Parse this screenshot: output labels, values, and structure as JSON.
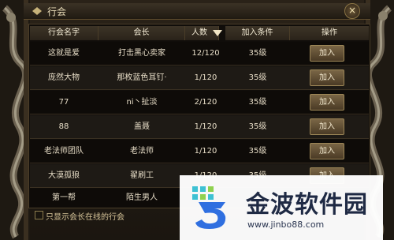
{
  "window": {
    "title": "行会",
    "close_symbol": "×"
  },
  "table": {
    "columns": [
      "行会名字",
      "会长",
      "人数",
      "加入条件",
      "操作"
    ],
    "sort_indicator": "down",
    "rows": [
      {
        "name": "这就是爱",
        "leader": "打击黑心卖家",
        "members": "12/120",
        "requirement": "35级",
        "action": "加入"
      },
      {
        "name": "庞然大物",
        "leader": "那枚蓝色耳钉·",
        "members": "1/120",
        "requirement": "35级",
        "action": "加入"
      },
      {
        "name": "77",
        "leader": "ni丶扯淡",
        "members": "2/120",
        "requirement": "35级",
        "action": "加入"
      },
      {
        "name": "88",
        "leader": "盖聂",
        "members": "1/120",
        "requirement": "35级",
        "action": "加入"
      },
      {
        "name": "老法师团队",
        "leader": "老法师",
        "members": "1/120",
        "requirement": "35级",
        "action": "加入"
      },
      {
        "name": "大漠孤狼",
        "leader": "翟刷工",
        "members": "1/120",
        "requirement": "35级",
        "action": "加入"
      },
      {
        "name": "第一帮",
        "leader": "陌生男人",
        "members": "",
        "requirement": "",
        "action": ""
      }
    ]
  },
  "filter": {
    "label": "只显示会长在线的行会",
    "checked": false
  },
  "watermark": {
    "brand": "金波软件园",
    "url": "www.jinbo88.com"
  },
  "colors": {
    "accent_gold": "#9c8657",
    "bg": "#1a1510"
  }
}
